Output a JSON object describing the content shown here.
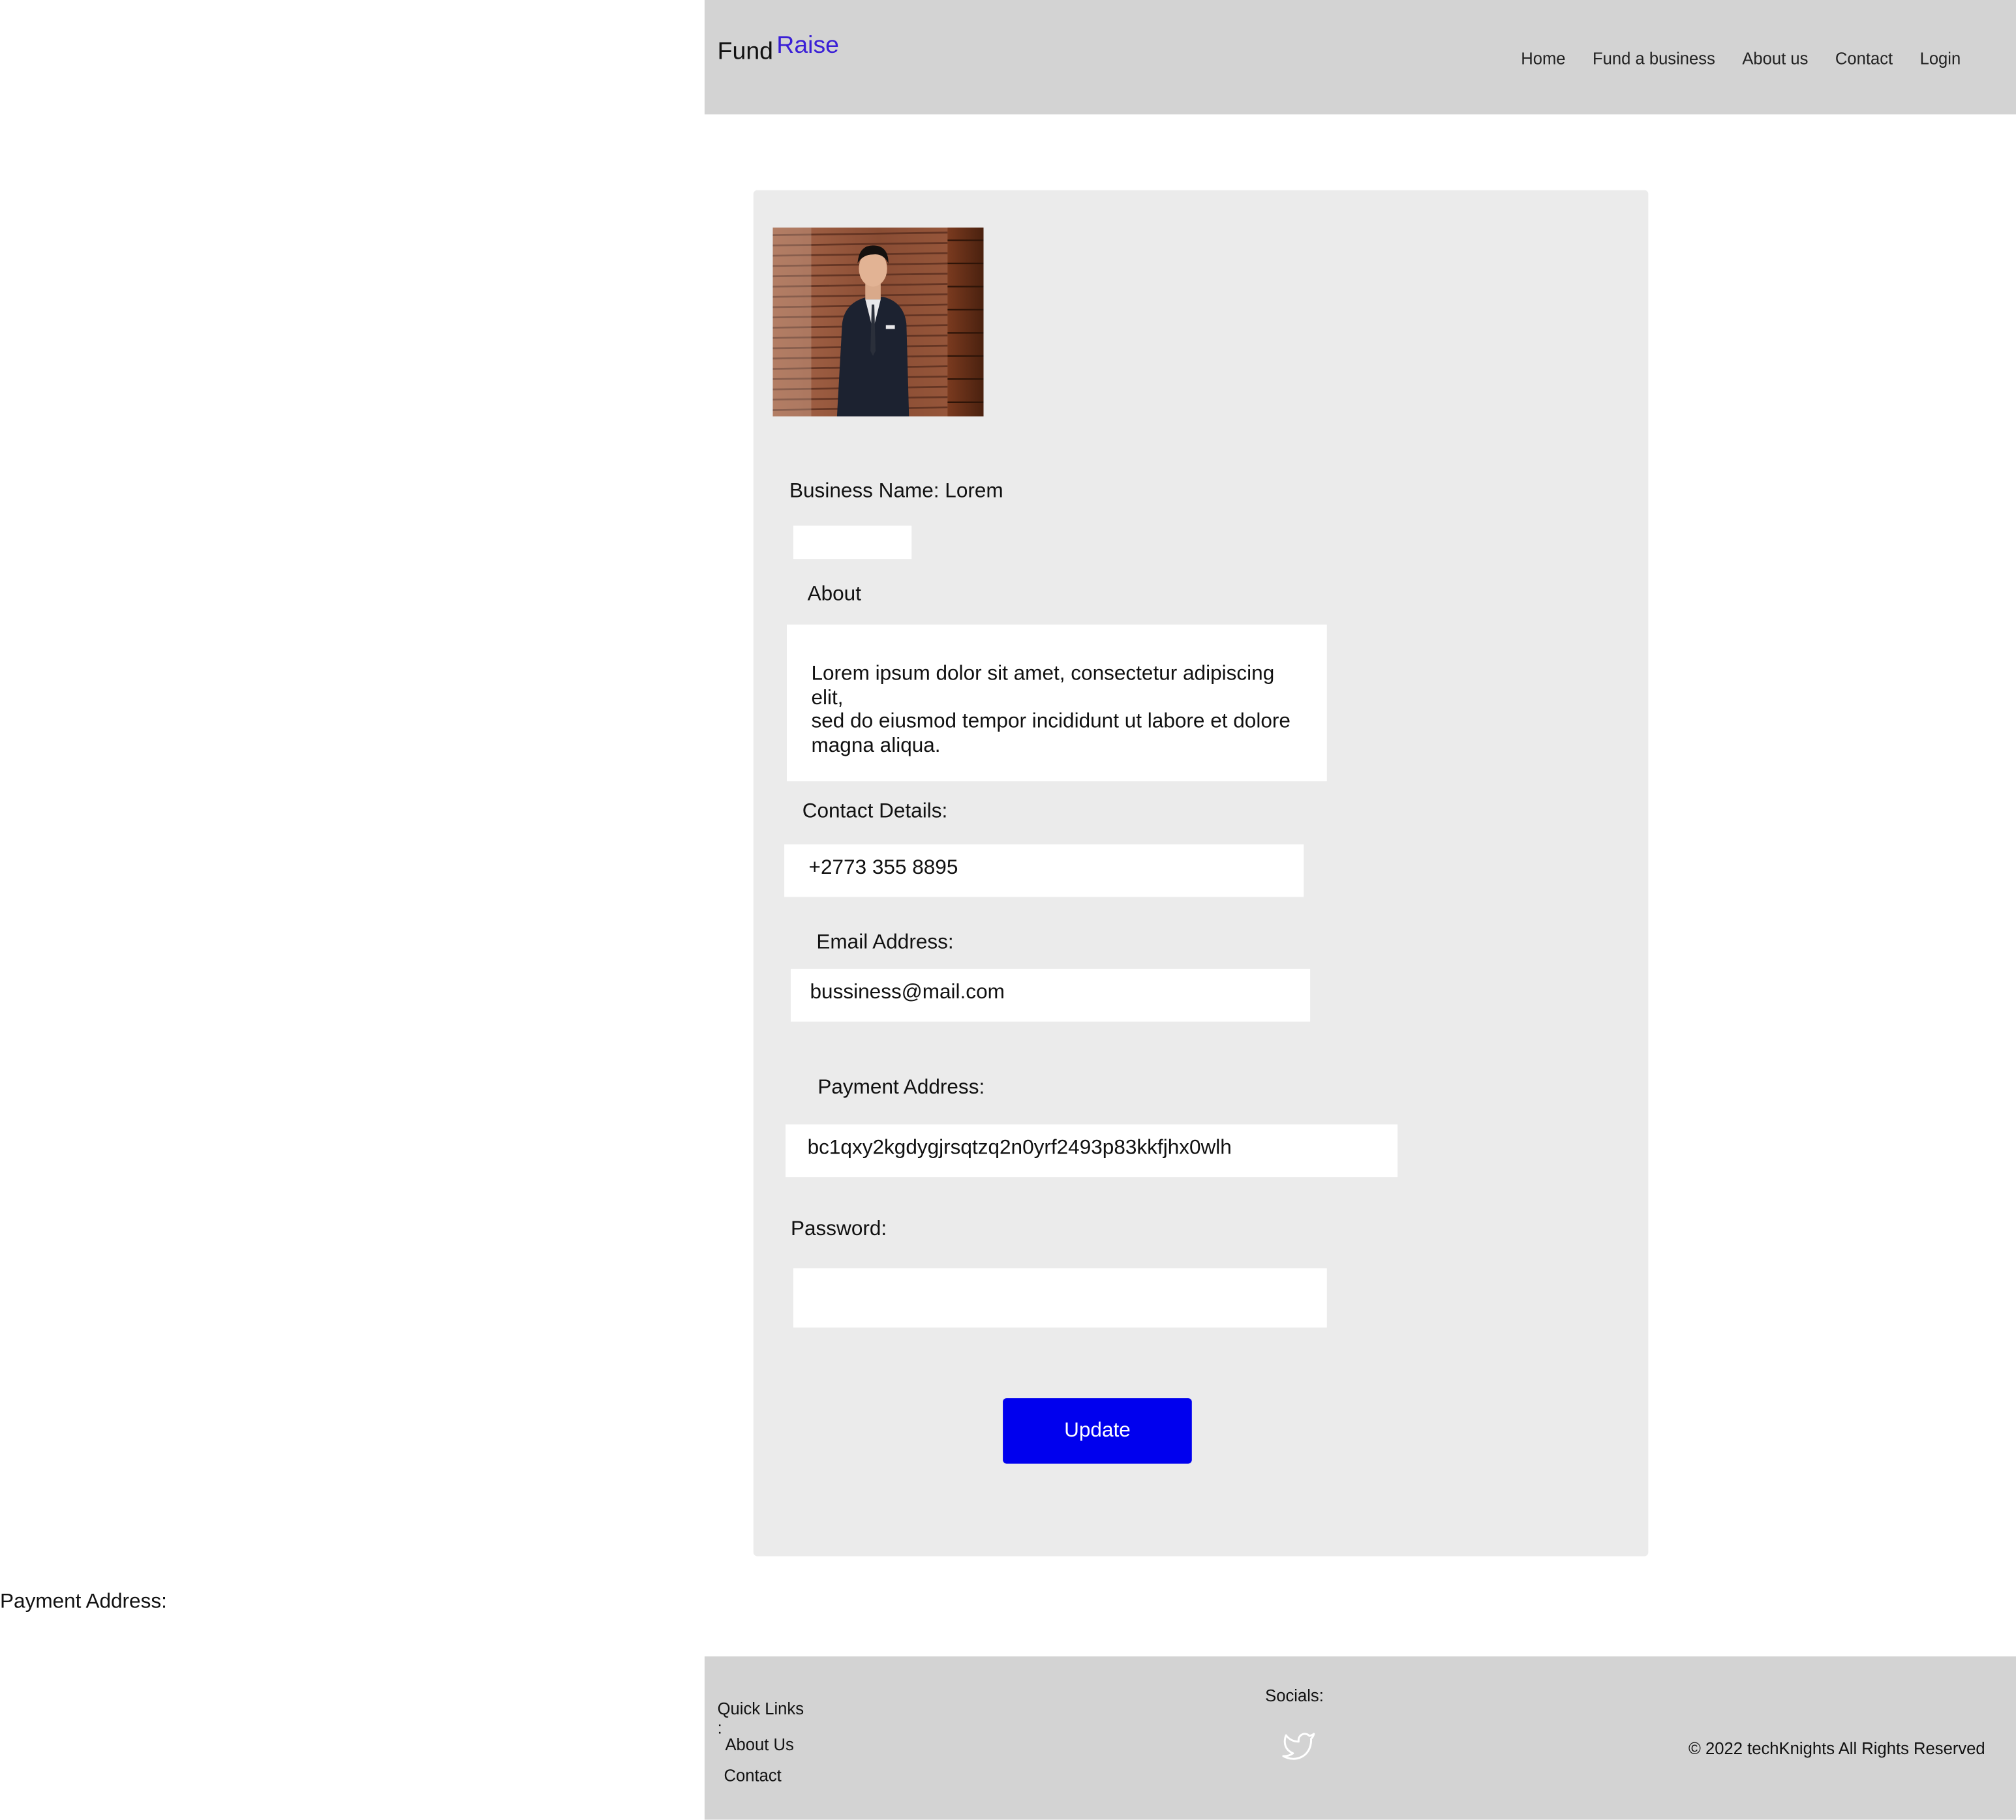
{
  "header": {
    "logo_part1": "Fund",
    "logo_part2": "Raise",
    "nav": [
      "Home",
      "Fund a business",
      "About us",
      "Contact",
      "Login"
    ]
  },
  "colors": {
    "header_bg": "#d3d3d3",
    "card_bg": "#ebebeb",
    "accent_blue": "#0000ee",
    "logo_raise": "#3a1fd6"
  },
  "profile": {
    "avatar_alt": "business owner photo",
    "business_name_label": "Business Name: Lorem",
    "business_name_value": "",
    "about_label": "About",
    "about_text": "Lorem ipsum dolor sit amet, consectetur adipiscing elit,\n sed do eiusmod tempor incididunt ut labore et dolore magna aliqua.",
    "contact_label": "Contact Details:",
    "contact_value": "+2773 355 8895",
    "email_label": "Email Address:",
    "email_value": "bussiness@mail.com",
    "payment_label": "Payment Address:",
    "payment_value": "bc1qxy2kgdygjrsqtzq2n0yrf2493p83kkfjhx0wlh",
    "password_label": "Password:",
    "password_value": "",
    "update_button": "Update"
  },
  "stray_label": "Payment Address:",
  "footer": {
    "quick_links_title": "Quick Links\n:",
    "quick_links": [
      "About Us",
      "Contact"
    ],
    "socials_title": "Socials:",
    "social_icon": "twitter-icon",
    "copyright": "© 2022 techKnights All Rights Reserved"
  }
}
